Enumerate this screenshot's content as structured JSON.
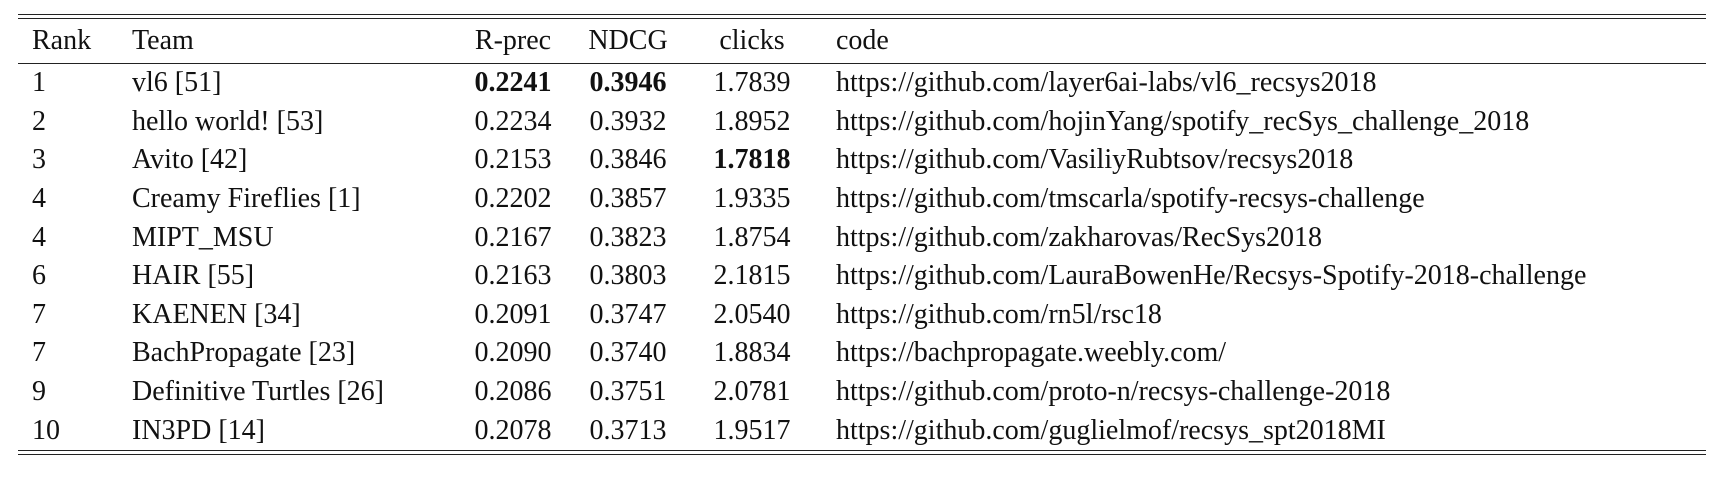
{
  "table": {
    "headers": {
      "rank": "Rank",
      "team": "Team",
      "rprec": "R-prec",
      "ndcg": "NDCG",
      "clicks": "clicks",
      "code": "code"
    },
    "rows": [
      {
        "rank": "1",
        "team": "vl6 [51]",
        "rprec": "0.2241",
        "ndcg": "0.3946",
        "clicks": "1.7839",
        "code": "https://github.com/layer6ai-labs/vl6_recsys2018"
      },
      {
        "rank": "2",
        "team": "hello world! [53]",
        "rprec": "0.2234",
        "ndcg": "0.3932",
        "clicks": "1.8952",
        "code": "https://github.com/hojinYang/spotify_recSys_challenge_2018"
      },
      {
        "rank": "3",
        "team": "Avito [42]",
        "rprec": "0.2153",
        "ndcg": "0.3846",
        "clicks": "1.7818",
        "code": "https://github.com/VasiliyRubtsov/recsys2018"
      },
      {
        "rank": "4",
        "team": "Creamy Fireflies [1]",
        "rprec": "0.2202",
        "ndcg": "0.3857",
        "clicks": "1.9335",
        "code": "https://github.com/tmscarla/spotify-recsys-challenge"
      },
      {
        "rank": "4",
        "team": "MIPT_MSU",
        "rprec": "0.2167",
        "ndcg": "0.3823",
        "clicks": "1.8754",
        "code": "https://github.com/zakharovas/RecSys2018"
      },
      {
        "rank": "6",
        "team": "HAIR [55]",
        "rprec": "0.2163",
        "ndcg": "0.3803",
        "clicks": "2.1815",
        "code": "https://github.com/LauraBowenHe/Recsys-Spotify-2018-challenge"
      },
      {
        "rank": "7",
        "team": "KAENEN [34]",
        "rprec": "0.2091",
        "ndcg": "0.3747",
        "clicks": "2.0540",
        "code": "https://github.com/rn5l/rsc18"
      },
      {
        "rank": "7",
        "team": "BachPropagate [23]",
        "rprec": "0.2090",
        "ndcg": "0.3740",
        "clicks": "1.8834",
        "code": "https://bachpropagate.weebly.com/"
      },
      {
        "rank": "9",
        "team": "Definitive Turtles [26]",
        "rprec": "0.2086",
        "ndcg": "0.3751",
        "clicks": "2.0781",
        "code": "https://github.com/proto-n/recsys-challenge-2018"
      },
      {
        "rank": "10",
        "team": "IN3PD [14]",
        "rprec": "0.2078",
        "ndcg": "0.3713",
        "clicks": "1.9517",
        "code": "https://github.com/guglielmof/recsys_spt2018MI"
      }
    ]
  }
}
